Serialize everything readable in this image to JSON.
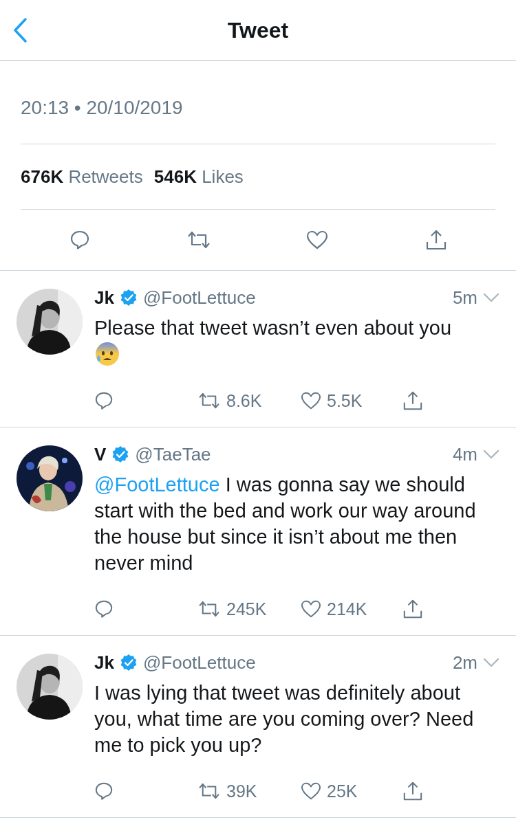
{
  "header": {
    "title": "Tweet"
  },
  "tweet": {
    "timestamp": "20:13 • 20/10/2019",
    "retweets": {
      "count": "676K",
      "label": "Retweets"
    },
    "likes": {
      "count": "546K",
      "label": "Likes"
    }
  },
  "replies": [
    {
      "name": "Jk",
      "verified": true,
      "handle": "@FootLettuce",
      "time": "5m",
      "text": "Please that tweet wasn’t even about you",
      "emoji": true,
      "retweets": "8.6K",
      "likes": "5.5K"
    },
    {
      "name": "V",
      "verified": true,
      "handle": "@TaeTae",
      "time": "4m",
      "mention": "@FootLettuce",
      "text": "I was gonna say we should start with the bed and work our way around the house but since it isn’t about me then never mind",
      "emoji": false,
      "retweets": "245K",
      "likes": "214K"
    },
    {
      "name": "Jk",
      "verified": true,
      "handle": "@FootLettuce",
      "time": "2m",
      "text": "I was lying that tweet was definitely about you, what time are you coming over? Need me to pick you up?",
      "emoji": false,
      "retweets": "39K",
      "likes": "25K"
    }
  ]
}
